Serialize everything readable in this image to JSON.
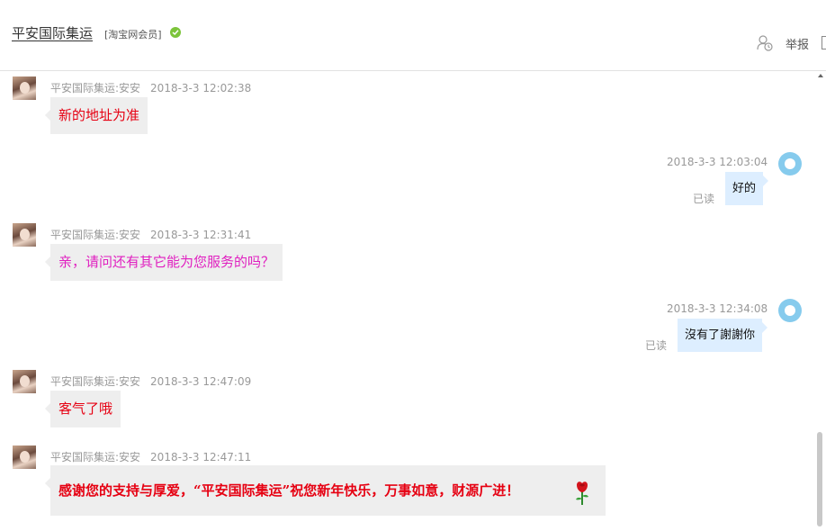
{
  "header": {
    "shop_name": "平安国际集运",
    "member_badge": "[淘宝网会员]",
    "verified_icon": "check-circle-icon",
    "contact_icon": "user-add-icon",
    "report_label": "举报"
  },
  "messages": [
    {
      "side": "left",
      "sender": "平安国际集运:安安",
      "time": "2018-3-3 12:02:38",
      "text": "新的地址为准",
      "color": "#e60012"
    },
    {
      "side": "right",
      "time": "2018-3-3 12:03:04",
      "text": "好的",
      "status": "已读"
    },
    {
      "side": "left",
      "sender": "平安国际集运:安安",
      "time": "2018-3-3 12:31:41",
      "text": "亲，请问还有其它能为您服务的吗？",
      "color": "#e020c0"
    },
    {
      "side": "right",
      "time": "2018-3-3 12:34:08",
      "text": "沒有了謝謝你",
      "status": "已读"
    },
    {
      "side": "left",
      "sender": "平安国际集运:安安",
      "time": "2018-3-3 12:47:09",
      "text": "客气了哦",
      "color": "#e60012"
    },
    {
      "side": "left",
      "sender": "平安国际集运:安安",
      "time": "2018-3-3 12:47:11",
      "text": "感谢您的支持与厚爱，“平安国际集运”祝您新年快乐，万事如意，财源广进！",
      "color": "#e60012",
      "icon": "rose-icon"
    }
  ]
}
